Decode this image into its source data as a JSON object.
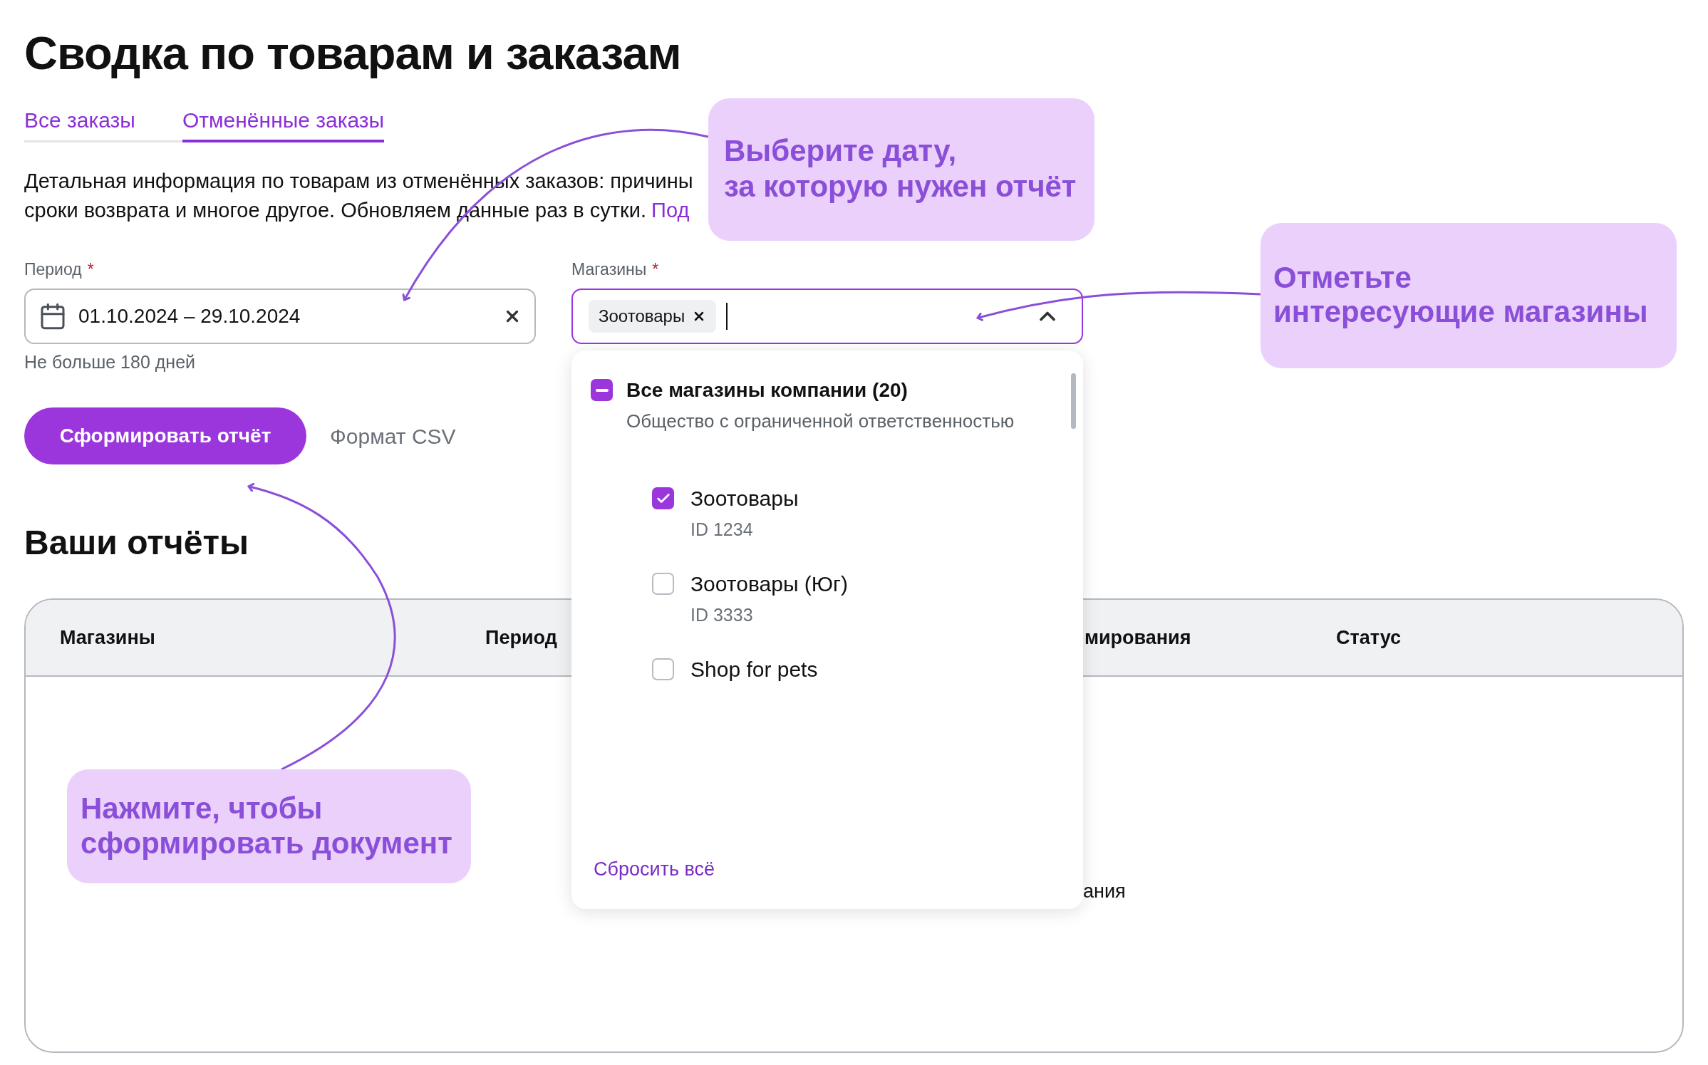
{
  "title": "Сводка по товарам и заказам",
  "tabs": [
    {
      "label": "Все заказы",
      "selected": false
    },
    {
      "label": "Отменённые заказы",
      "selected": true
    }
  ],
  "description": {
    "lines": [
      "Детальная информация по товарам из отменённых заказов: причины",
      "сроки возврата и многое другое. Обновляем данные раз в сутки."
    ],
    "link": "Под"
  },
  "form": {
    "period": {
      "label": "Период",
      "required_mark": "*",
      "value": "01.10.2024 – 29.10.2024",
      "hint": "Не больше 180 дней"
    },
    "shops": {
      "label": "Магазины",
      "required_mark": "*",
      "chips": [
        "Зоотовары"
      ],
      "expanded": true
    }
  },
  "actions": {
    "submit": "Сформировать отчёт",
    "format": "Формат CSV"
  },
  "reports": {
    "title": "Ваши отчёты",
    "columns": [
      "Магазины",
      "Период",
      "мирования",
      "Статус"
    ],
    "empty_text": "ания"
  },
  "dropdown": {
    "items": [
      {
        "label": "Все магазины компании (20)",
        "subtitle": "Общество с ограниченной ответственностью",
        "indeterminate": true,
        "children": [
          {
            "label": "Зоотовары",
            "subtitle": "ID 1234",
            "checked": true
          },
          {
            "label": "Зоотовары (Юг)",
            "subtitle": "ID 3333",
            "checked": false
          },
          {
            "label": "Shop for pets",
            "checked": false
          }
        ]
      }
    ],
    "reset": "Сбросить всё"
  },
  "callouts": [
    {
      "lines": [
        "Выберите дату,",
        "за которую нужен отчёт"
      ]
    },
    {
      "lines": [
        "Отметьте",
        "интересующие магазины"
      ]
    },
    {
      "lines": [
        "Нажмите, чтобы",
        "сформировать документ"
      ]
    }
  ]
}
